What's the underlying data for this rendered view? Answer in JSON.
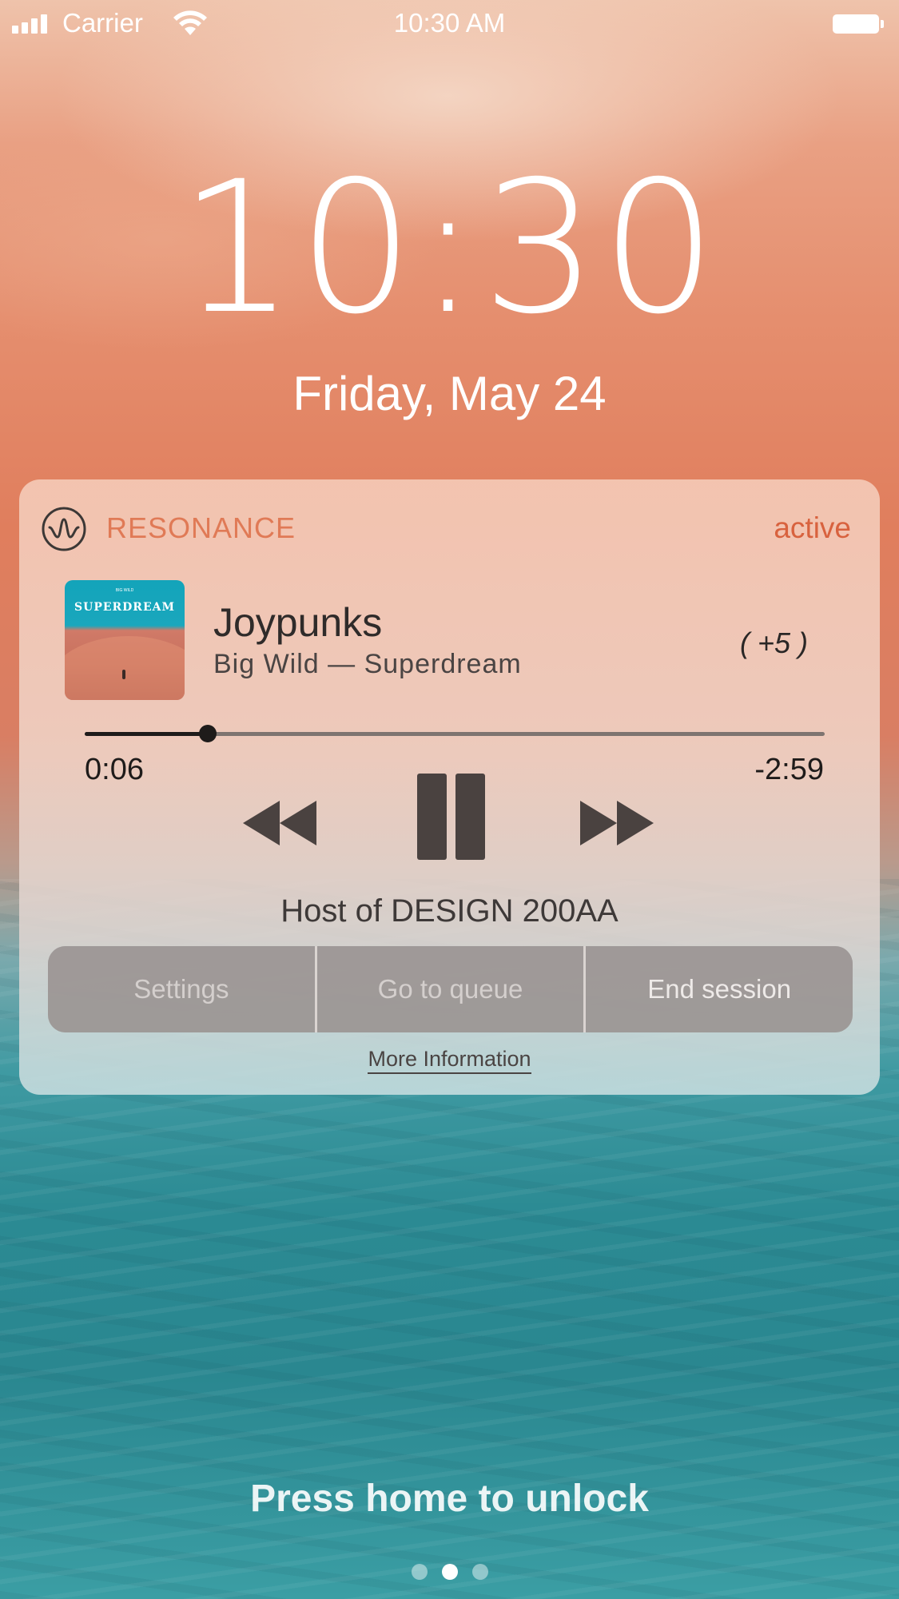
{
  "status_bar": {
    "carrier": "Carrier",
    "time": "10:30 AM"
  },
  "lock_screen": {
    "time": "10:30",
    "date": "Friday, May 24",
    "unlock_hint": "Press home to unlock",
    "page_dots": 3,
    "active_page_dot": 2
  },
  "notification": {
    "app_name": "RESONANCE",
    "status": "active",
    "accent_color": "#e07a56",
    "status_color": "#d8623e",
    "track": {
      "title": "Joypunks",
      "subtitle": "Big Wild — Superdream",
      "album_art_text": "SUPERDREAM",
      "album_art_brand": "BIG WILD",
      "vote": "( +5 )"
    },
    "playback": {
      "elapsed": "0:06",
      "remaining": "-2:59",
      "progress": 0.166,
      "state": "playing"
    },
    "controls": {
      "rewind_icon": "rewind-icon",
      "pause_icon": "pause-icon",
      "forward_icon": "fast-forward-icon"
    },
    "host_text": "Host of DESIGN 200AA",
    "buttons": {
      "settings": "Settings",
      "queue": "Go to queue",
      "end": "End session"
    },
    "more_info": "More Information"
  }
}
